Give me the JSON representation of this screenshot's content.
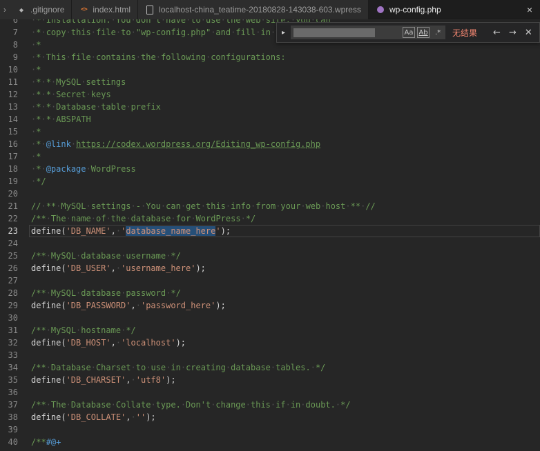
{
  "window": {
    "overflow_chevron": "›"
  },
  "theme": {
    "editor_bg": "#262626",
    "tab_active_bg": "#1d1d1d",
    "tab_inactive_bg": "#2d2d2d",
    "comment": "#6a9955",
    "string": "#ce9178",
    "tag": "#569cd6",
    "plain": "#d4d4d4",
    "selection": "#264f78",
    "line_number": "#8a8a8a",
    "no_results": "#f48771",
    "find_bg": "#252526",
    "whitespace_dot": "#505050",
    "current_line_border": "#424242"
  },
  "tabs": [
    {
      "label": ".gitignore",
      "icon": "gitignore-icon",
      "icon_glyph": "◆",
      "active": false
    },
    {
      "label": "index.html",
      "icon": "html-icon",
      "icon_glyph": "<>",
      "active": false
    },
    {
      "label": "localhost-china_teatime-20180828-143038-603.wpress",
      "icon": "file-icon",
      "active": false
    },
    {
      "label": "wp-config.php",
      "icon": "php-icon",
      "active": true,
      "close_glyph": "×"
    }
  ],
  "find": {
    "replace_expand_arrow": "▸",
    "input_value": "",
    "toggles": [
      {
        "name": "match-case",
        "label": "Aa"
      },
      {
        "name": "whole-word",
        "label": "Ab"
      },
      {
        "name": "regex",
        "label": ".*"
      }
    ],
    "no_results": "无结果",
    "prev_arrow": "←",
    "next_arrow": "→",
    "close_glyph": "✕"
  },
  "editor": {
    "lines": [
      {
        "num": 6,
        "tokens": [
          {
            "c": "comment",
            "s": " * installation. You don't have to use the web site, you can"
          }
        ]
      },
      {
        "num": 7,
        "tokens": [
          {
            "c": "comment",
            "s": " * copy this file to \"wp-config.php\" and fill in the values."
          }
        ]
      },
      {
        "num": 8,
        "tokens": [
          {
            "c": "comment",
            "s": " *"
          }
        ]
      },
      {
        "num": 9,
        "tokens": [
          {
            "c": "comment",
            "s": " * This file contains the following configurations:"
          }
        ]
      },
      {
        "num": 10,
        "tokens": [
          {
            "c": "comment",
            "s": " *"
          }
        ]
      },
      {
        "num": 11,
        "tokens": [
          {
            "c": "comment",
            "s": " * * MySQL settings"
          }
        ]
      },
      {
        "num": 12,
        "tokens": [
          {
            "c": "comment",
            "s": " * * Secret keys"
          }
        ]
      },
      {
        "num": 13,
        "tokens": [
          {
            "c": "comment",
            "s": " * * Database table prefix"
          }
        ]
      },
      {
        "num": 14,
        "tokens": [
          {
            "c": "comment",
            "s": " * * ABSPATH"
          }
        ]
      },
      {
        "num": 15,
        "tokens": [
          {
            "c": "comment",
            "s": " *"
          }
        ]
      },
      {
        "num": 16,
        "tokens": [
          {
            "c": "comment",
            "s": " * "
          },
          {
            "c": "tag",
            "s": "@link"
          },
          {
            "c": "comment",
            "s": " "
          },
          {
            "c": "link",
            "s": "https://codex.wordpress.org/Editing_wp-config.php"
          }
        ]
      },
      {
        "num": 17,
        "tokens": [
          {
            "c": "comment",
            "s": " *"
          }
        ]
      },
      {
        "num": 18,
        "tokens": [
          {
            "c": "comment",
            "s": " * "
          },
          {
            "c": "tag",
            "s": "@package"
          },
          {
            "c": "comment",
            "s": " WordPress"
          }
        ]
      },
      {
        "num": 19,
        "tokens": [
          {
            "c": "comment",
            "s": " */"
          }
        ]
      },
      {
        "num": 20,
        "tokens": []
      },
      {
        "num": 21,
        "tokens": [
          {
            "c": "comment",
            "s": "// ** MySQL settings - You can get this info from your web host ** //"
          }
        ]
      },
      {
        "num": 22,
        "tokens": [
          {
            "c": "comment",
            "s": "/** The name of the database for WordPress */"
          }
        ]
      },
      {
        "num": 23,
        "current": true,
        "tokens": [
          {
            "c": "plain",
            "s": "define("
          },
          {
            "c": "string",
            "s": "'DB_NAME'"
          },
          {
            "c": "plain",
            "s": ", "
          },
          {
            "c": "string",
            "s": "'"
          },
          {
            "c": "string",
            "s": "database_name_here",
            "sel": true
          },
          {
            "c": "string",
            "s": "'"
          },
          {
            "c": "plain",
            "s": ");"
          }
        ]
      },
      {
        "num": 24,
        "tokens": []
      },
      {
        "num": 25,
        "tokens": [
          {
            "c": "comment",
            "s": "/** MySQL database username */"
          }
        ]
      },
      {
        "num": 26,
        "tokens": [
          {
            "c": "plain",
            "s": "define("
          },
          {
            "c": "string",
            "s": "'DB_USER'"
          },
          {
            "c": "plain",
            "s": ", "
          },
          {
            "c": "string",
            "s": "'username_here'"
          },
          {
            "c": "plain",
            "s": ");"
          }
        ]
      },
      {
        "num": 27,
        "tokens": []
      },
      {
        "num": 28,
        "tokens": [
          {
            "c": "comment",
            "s": "/** MySQL database password */"
          }
        ]
      },
      {
        "num": 29,
        "tokens": [
          {
            "c": "plain",
            "s": "define("
          },
          {
            "c": "string",
            "s": "'DB_PASSWORD'"
          },
          {
            "c": "plain",
            "s": ", "
          },
          {
            "c": "string",
            "s": "'password_here'"
          },
          {
            "c": "plain",
            "s": ");"
          }
        ]
      },
      {
        "num": 30,
        "tokens": []
      },
      {
        "num": 31,
        "tokens": [
          {
            "c": "comment",
            "s": "/** MySQL hostname */"
          }
        ]
      },
      {
        "num": 32,
        "tokens": [
          {
            "c": "plain",
            "s": "define("
          },
          {
            "c": "string",
            "s": "'DB_HOST'"
          },
          {
            "c": "plain",
            "s": ", "
          },
          {
            "c": "string",
            "s": "'localhost'"
          },
          {
            "c": "plain",
            "s": ");"
          }
        ]
      },
      {
        "num": 33,
        "tokens": []
      },
      {
        "num": 34,
        "tokens": [
          {
            "c": "comment",
            "s": "/** Database Charset to use in creating database tables. */"
          }
        ]
      },
      {
        "num": 35,
        "tokens": [
          {
            "c": "plain",
            "s": "define("
          },
          {
            "c": "string",
            "s": "'DB_CHARSET'"
          },
          {
            "c": "plain",
            "s": ", "
          },
          {
            "c": "string",
            "s": "'utf8'"
          },
          {
            "c": "plain",
            "s": ");"
          }
        ]
      },
      {
        "num": 36,
        "tokens": []
      },
      {
        "num": 37,
        "tokens": [
          {
            "c": "comment",
            "s": "/** The Database Collate type. Don't change this if in doubt. */"
          }
        ]
      },
      {
        "num": 38,
        "tokens": [
          {
            "c": "plain",
            "s": "define("
          },
          {
            "c": "string",
            "s": "'DB_COLLATE'"
          },
          {
            "c": "plain",
            "s": ", "
          },
          {
            "c": "string",
            "s": "''"
          },
          {
            "c": "plain",
            "s": ");"
          }
        ]
      },
      {
        "num": 39,
        "tokens": []
      },
      {
        "num": 40,
        "tokens": [
          {
            "c": "comment",
            "s": "/**"
          },
          {
            "c": "tag",
            "s": "#@+"
          }
        ]
      }
    ]
  }
}
